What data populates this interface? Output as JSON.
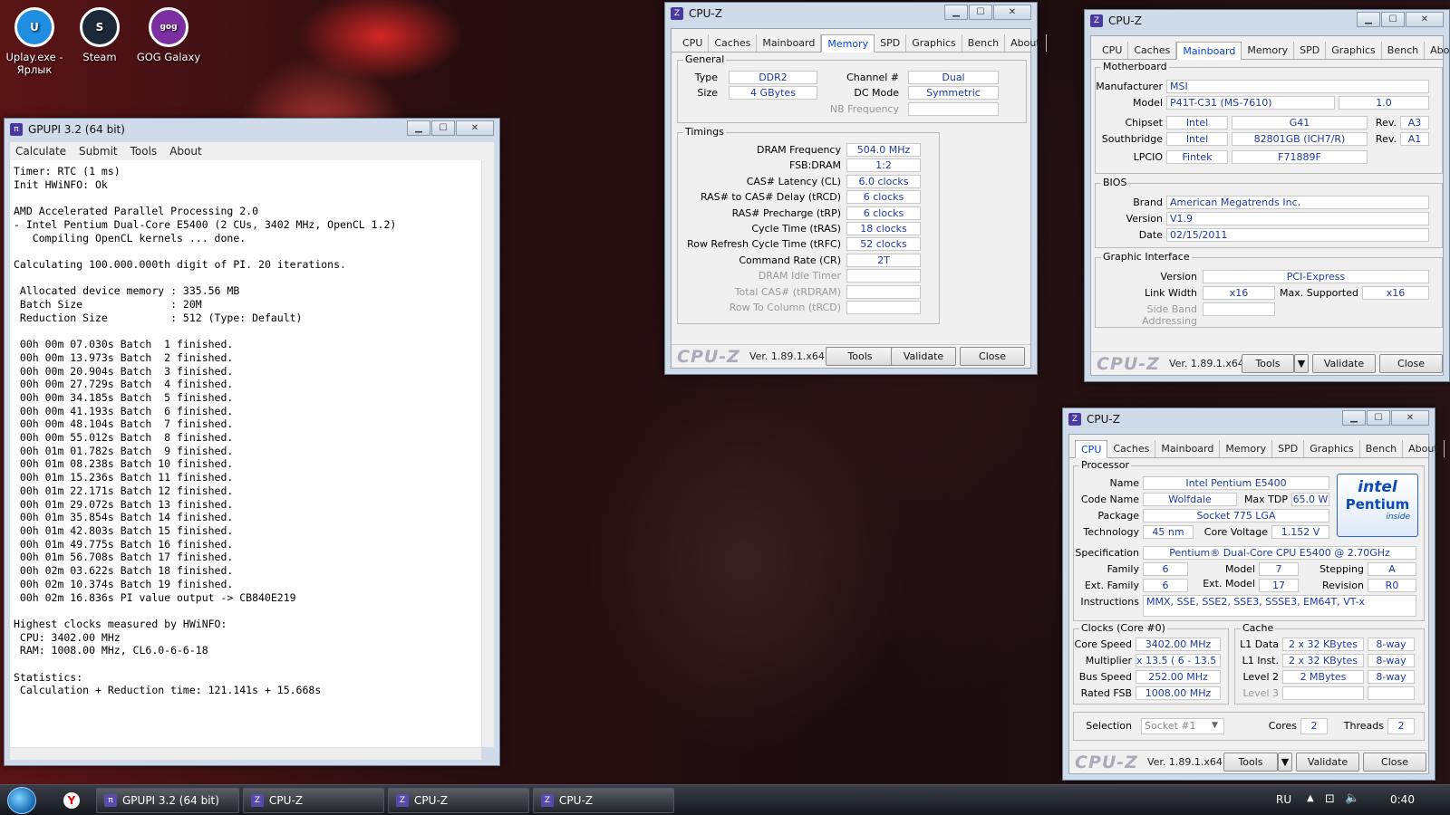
{
  "desktop": {
    "icons": [
      {
        "label": "Uplay.exe - Ярлык",
        "glyph": "U",
        "color": "#1f8de0"
      },
      {
        "label": "Steam",
        "glyph": "S",
        "color": "#1b2838"
      },
      {
        "label": "GOG Galaxy",
        "glyph": "gog com",
        "color": "#7b2fa0"
      }
    ]
  },
  "gpupi": {
    "title": "GPUPI 3.2 (64 bit)",
    "menu": [
      "Calculate",
      "Submit",
      "Tools",
      "About"
    ],
    "log": "Timer: RTC (1 ms)\nInit HWiNFO: Ok\n\nAMD Accelerated Parallel Processing 2.0\n- Intel Pentium Dual-Core E5400 (2 CUs, 3402 MHz, OpenCL 1.2)\n   Compiling OpenCL kernels ... done.\n\nCalculating 100.000.000th digit of PI. 20 iterations.\n\n Allocated device memory : 335.56 MB\n Batch Size              : 20M\n Reduction Size          : 512 (Type: Default)\n\n 00h 00m 07.030s Batch  1 finished.\n 00h 00m 13.973s Batch  2 finished.\n 00h 00m 20.904s Batch  3 finished.\n 00h 00m 27.729s Batch  4 finished.\n 00h 00m 34.185s Batch  5 finished.\n 00h 00m 41.193s Batch  6 finished.\n 00h 00m 48.104s Batch  7 finished.\n 00h 00m 55.012s Batch  8 finished.\n 00h 01m 01.782s Batch  9 finished.\n 00h 01m 08.238s Batch 10 finished.\n 00h 01m 15.236s Batch 11 finished.\n 00h 01m 22.171s Batch 12 finished.\n 00h 01m 29.072s Batch 13 finished.\n 00h 01m 35.854s Batch 14 finished.\n 00h 01m 42.803s Batch 15 finished.\n 00h 01m 49.775s Batch 16 finished.\n 00h 01m 56.708s Batch 17 finished.\n 00h 02m 03.622s Batch 18 finished.\n 00h 02m 10.374s Batch 19 finished.\n 00h 02m 16.836s PI value output -> CB840E219\n\nHighest clocks measured by HWiNFO:\n CPU: 3402.00 MHz\n RAM: 1008.00 MHz, CL6.0-6-6-18\n\nStatistics:\n Calculation + Reduction time: 121.141s + 15.668s"
  },
  "cpuz_common": {
    "title": "CPU-Z",
    "tabs": [
      "CPU",
      "Caches",
      "Mainboard",
      "Memory",
      "SPD",
      "Graphics",
      "Bench",
      "About"
    ],
    "logo": "CPU-Z",
    "version": "Ver. 1.89.1.x64",
    "tools": "Tools",
    "validate": "Validate",
    "close": "Close"
  },
  "memory": {
    "general_label": "General",
    "type_label": "Type",
    "type": "DDR2",
    "size_label": "Size",
    "size": "4 GBytes",
    "channel_label": "Channel #",
    "channel": "Dual",
    "dcmode_label": "DC Mode",
    "dcmode": "Symmetric",
    "nbfreq_label": "NB Frequency",
    "timings_label": "Timings",
    "rows": [
      {
        "label": "DRAM Frequency",
        "value": "504.0 MHz",
        "dim": false
      },
      {
        "label": "FSB:DRAM",
        "value": "1:2",
        "dim": false
      },
      {
        "label": "CAS# Latency (CL)",
        "value": "6.0 clocks",
        "dim": false
      },
      {
        "label": "RAS# to CAS# Delay (tRCD)",
        "value": "6 clocks",
        "dim": false
      },
      {
        "label": "RAS# Precharge (tRP)",
        "value": "6 clocks",
        "dim": false
      },
      {
        "label": "Cycle Time (tRAS)",
        "value": "18 clocks",
        "dim": false
      },
      {
        "label": "Row Refresh Cycle Time (tRFC)",
        "value": "52 clocks",
        "dim": false
      },
      {
        "label": "Command Rate (CR)",
        "value": "2T",
        "dim": false
      },
      {
        "label": "DRAM Idle Timer",
        "value": "",
        "dim": true
      },
      {
        "label": "Total CAS# (tRDRAM)",
        "value": "",
        "dim": true
      },
      {
        "label": "Row To Column (tRCD)",
        "value": "",
        "dim": true
      }
    ]
  },
  "mainboard": {
    "mb_label": "Motherboard",
    "manufacturer_label": "Manufacturer",
    "manufacturer": "MSI",
    "model_label": "Model",
    "model": "P41T-C31 (MS-7610)",
    "model_rev": "1.0",
    "chipset_label": "Chipset",
    "chipset_vendor": "Intel",
    "chipset": "G41",
    "chipset_rev_label": "Rev.",
    "chipset_rev": "A3",
    "south_label": "Southbridge",
    "south_vendor": "Intel",
    "south": "82801GB (ICH7/R)",
    "south_rev_label": "Rev.",
    "south_rev": "A1",
    "lpcio_label": "LPCIO",
    "lpcio_vendor": "Fintek",
    "lpcio": "F71889F",
    "bios_label": "BIOS",
    "brand_label": "Brand",
    "brand": "American Megatrends Inc.",
    "version_label": "Version",
    "version": "V1.9",
    "date_label": "Date",
    "date": "02/15/2011",
    "gi_label": "Graphic Interface",
    "gi_version_label": "Version",
    "gi_version": "PCI-Express",
    "lw_label": "Link Width",
    "lw": "x16",
    "ms_label": "Max. Supported",
    "ms": "x16",
    "sba_label": "Side Band Addressing"
  },
  "cpu": {
    "processor_label": "Processor",
    "name_label": "Name",
    "name": "Intel Pentium E5400",
    "codename_label": "Code Name",
    "codename": "Wolfdale",
    "maxtdp_label": "Max TDP",
    "maxtdp": "65.0 W",
    "package_label": "Package",
    "package": "Socket 775 LGA",
    "tech_label": "Technology",
    "tech": "45 nm",
    "cv_label": "Core Voltage",
    "cv": "1.152 V",
    "spec_label": "Specification",
    "spec": "Pentium® Dual-Core  CPU     E5400  @ 2.70GHz",
    "family_label": "Family",
    "family": "6",
    "model_label": "Model",
    "model": "7",
    "stepping_label": "Stepping",
    "stepping": "A",
    "extfamily_label": "Ext. Family",
    "extfamily": "6",
    "extmodel_label": "Ext. Model",
    "extmodel": "17",
    "revision_label": "Revision",
    "revision": "R0",
    "instr_label": "Instructions",
    "instr": "MMX, SSE, SSE2, SSE3, SSSE3, EM64T, VT-x",
    "clocks_label": "Clocks (Core #0)",
    "cs_label": "Core Speed",
    "cs": "3402.00 MHz",
    "mult_label": "Multiplier",
    "mult": "x 13.5 ( 6 - 13.5 )",
    "bus_label": "Bus Speed",
    "bus": "252.00 MHz",
    "fsb_label": "Rated FSB",
    "fsb": "1008.00 MHz",
    "cache_label": "Cache",
    "l1d_label": "L1 Data",
    "l1d": "2 x 32 KBytes",
    "l1d_way": "8-way",
    "l1i_label": "L1 Inst.",
    "l1i": "2 x 32 KBytes",
    "l1i_way": "8-way",
    "l2_label": "Level 2",
    "l2": "2 MBytes",
    "l2_way": "8-way",
    "l3_label": "Level 3",
    "selection_label": "Selection",
    "selection": "Socket #1",
    "cores_label": "Cores",
    "cores": "2",
    "threads_label": "Threads",
    "threads": "2",
    "logo_top": "intel",
    "logo_mid": "Pentium",
    "logo_bot": "inside"
  },
  "taskbar": {
    "items": [
      {
        "label": "GPUPI 3.2 (64 bit)"
      },
      {
        "label": "CPU-Z"
      },
      {
        "label": "CPU-Z"
      },
      {
        "label": "CPU-Z"
      }
    ],
    "lang": "RU",
    "time": "0:40"
  }
}
